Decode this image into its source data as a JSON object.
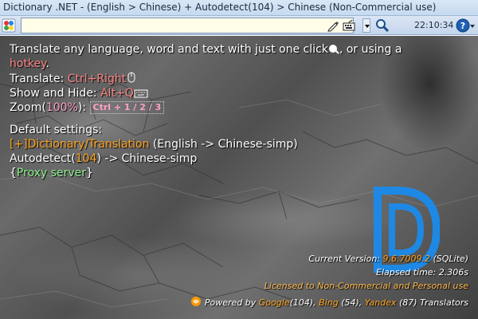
{
  "window": {
    "title": "Dictionary .NET - (English > Chinese) + Autodetect(104) > Chinese (Non-Commercial use)"
  },
  "toolbar": {
    "search_value": "",
    "clock": "22:10:34",
    "icons": [
      "app-icon",
      "pen-icon",
      "keyboard-icon",
      "chevron-down-icon",
      "magnifier-icon",
      "help-icon"
    ]
  },
  "intro": {
    "line1": "Translate any language, word and text with just one click",
    "line1_after_icon": ", or using a",
    "hotkey_word": "hotkey",
    "hotkey_after": "."
  },
  "shortcuts": {
    "translate_label": "Translate: ",
    "translate_keys": "Ctrl+Right",
    "show_hide_label": "Show and Hide: ",
    "show_hide_keys": "Alt+Q",
    "zoom_label": "Zoom(",
    "zoom_value": "100%",
    "zoom_after": "): ",
    "zoom_keys": "Ctrl + 1 / 2 / 3"
  },
  "defaults": {
    "heading": "Default settings:",
    "dictionary_link": "[+]Dictionary/Translation",
    "dictionary_langs": " (English -> Chinese-simp)",
    "autodetect_prefix": "Autodetect(",
    "autodetect_count": "104",
    "autodetect_suffix": ") -> Chinese-simp",
    "proxy_open": "{",
    "proxy_link": "Proxy server",
    "proxy_close": "}"
  },
  "footer": {
    "version_label": "Current Version: ",
    "version_value": "9.6.7009.2",
    "version_db": " (SQLite)",
    "elapsed_label": "Elapsed time: ",
    "elapsed_value": "2.306s",
    "license": "Licensed to Non-Commercial and Personal use",
    "powered_prefix": "Powered by ",
    "google": "Google",
    "google_count": "(104), ",
    "bing": "Bing",
    "bing_count": " (54), ",
    "yandex": "Yandex",
    "yandex_count": " (87) Translators"
  },
  "colors": {
    "accent_red": "#ff8585",
    "accent_orange": "#ffa31f",
    "accent_green": "#8df08d",
    "logo_blue": "#1e88e5"
  }
}
